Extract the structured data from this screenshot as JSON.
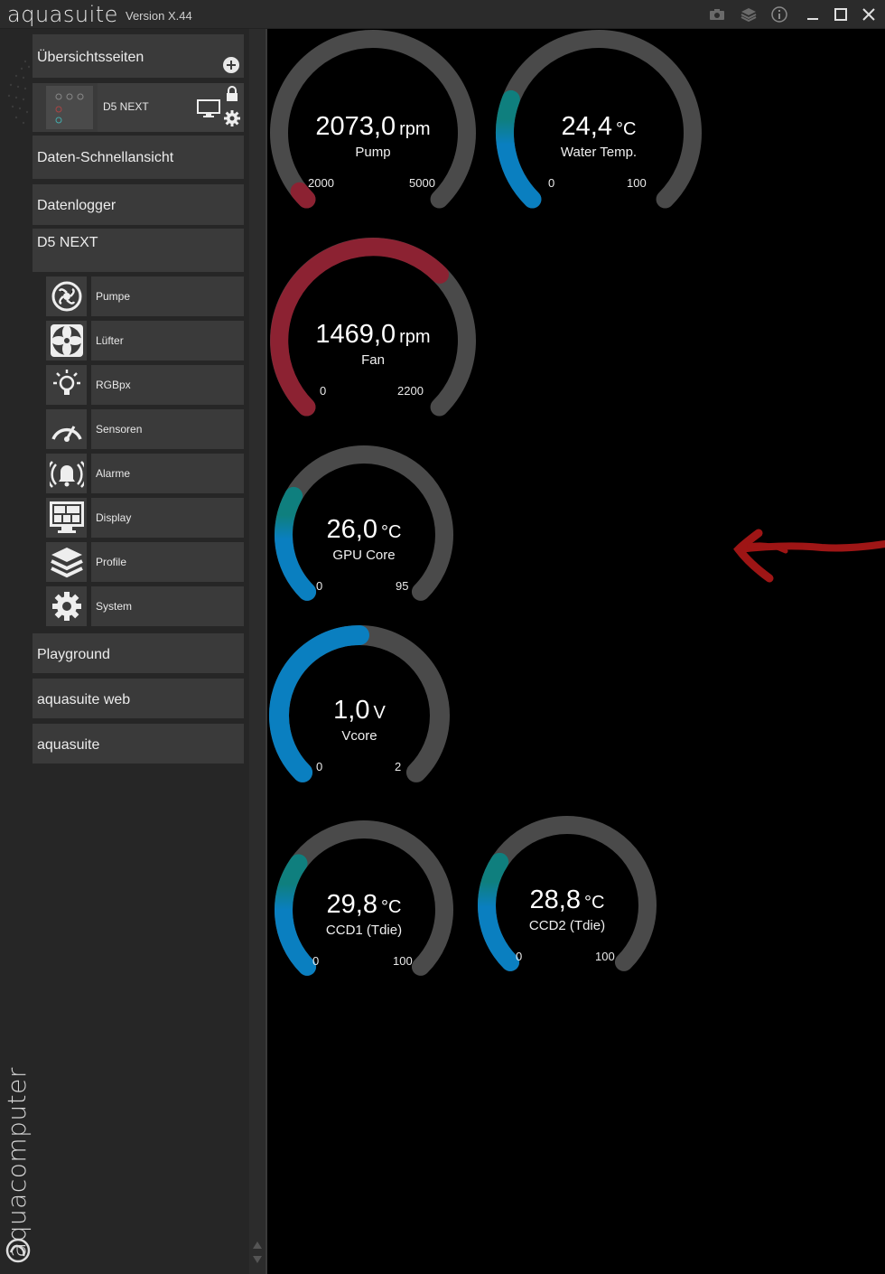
{
  "window": {
    "title": "aquasuite",
    "version": "Version X.44"
  },
  "sidebar": {
    "overview_header": "Übersichtsseiten",
    "overview_page": {
      "label": "D5 NEXT"
    },
    "items": [
      {
        "label": "Daten-Schnellansicht"
      },
      {
        "label": "Datenlogger"
      },
      {
        "label": "D5 NEXT"
      }
    ],
    "device_submenu": [
      {
        "label": "Pumpe",
        "icon": "pump-icon"
      },
      {
        "label": "Lüfter",
        "icon": "fan-icon"
      },
      {
        "label": "RGBpx",
        "icon": "lightbulb-icon"
      },
      {
        "label": "Sensoren",
        "icon": "gauge-icon"
      },
      {
        "label": "Alarme",
        "icon": "alarm-bell-icon"
      },
      {
        "label": "Display",
        "icon": "display-icon"
      },
      {
        "label": "Profile",
        "icon": "layers-icon"
      },
      {
        "label": "System",
        "icon": "gear-icon"
      }
    ],
    "bottom_items": [
      {
        "label": "Playground"
      },
      {
        "label": "aquasuite web"
      },
      {
        "label": "aquasuite"
      }
    ],
    "brand_vertical": "aquacomputer"
  },
  "colors": {
    "track": "#4a4a4a",
    "red": "#8c2232",
    "blue": "#0a7fc0",
    "teal": "#0f7f7e"
  },
  "gauges": [
    {
      "value": "2073,0",
      "unit": "rpm",
      "label": "Pump",
      "min": "2000",
      "max": "5000",
      "fraction": 0.024,
      "color": "red"
    },
    {
      "value": "24,4",
      "unit": "°C",
      "label": "Water Temp.",
      "min": "0",
      "max": "100",
      "fraction": 0.244,
      "color": "blue-teal"
    },
    {
      "value": "1469,0",
      "unit": "rpm",
      "label": "Fan",
      "min": "0",
      "max": "2200",
      "fraction": 0.668,
      "color": "red"
    },
    {
      "value": "26,0",
      "unit": "°C",
      "label": "GPU Core",
      "min": "0",
      "max": "95",
      "fraction": 0.274,
      "color": "blue-teal"
    },
    {
      "value": "1,0",
      "unit": "V",
      "label": "Vcore",
      "min": "0",
      "max": "2",
      "fraction": 0.5,
      "color": "blue"
    },
    {
      "value": "29,8",
      "unit": "°C",
      "label": "CCD1 (Tdie)",
      "min": "0",
      "max": "100",
      "fraction": 0.298,
      "color": "blue-teal"
    },
    {
      "value": "28,8",
      "unit": "°C",
      "label": "CCD2 (Tdie)",
      "min": "0",
      "max": "100",
      "fraction": 0.288,
      "color": "blue-teal"
    }
  ],
  "watermark": "aquasuite"
}
